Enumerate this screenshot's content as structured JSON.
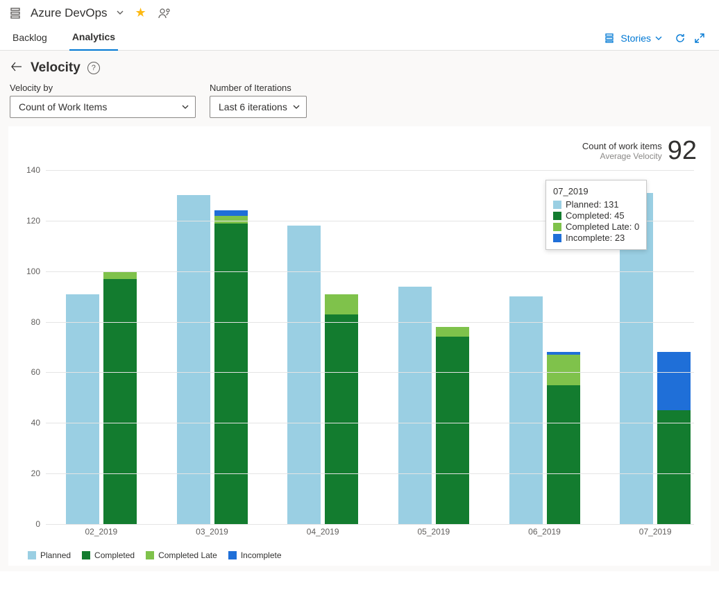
{
  "header": {
    "project": "Azure DevOps"
  },
  "tabs": {
    "backlog": "Backlog",
    "analytics": "Analytics"
  },
  "toolbar": {
    "stories_label": "Stories"
  },
  "page": {
    "title": "Velocity"
  },
  "filters": {
    "velocity_by_label": "Velocity by",
    "velocity_by_value": "Count of Work Items",
    "iterations_label": "Number of Iterations",
    "iterations_value": "Last 6 iterations"
  },
  "metric": {
    "line1": "Count of work items",
    "line2": "Average Velocity",
    "value": "92"
  },
  "legend": {
    "planned": "Planned",
    "completed": "Completed",
    "late": "Completed Late",
    "incomplete": "Incomplete"
  },
  "tooltip": {
    "title": "07_2019",
    "rows": [
      {
        "label": "Planned: 131",
        "color": "#9acfe3"
      },
      {
        "label": "Completed: 45",
        "color": "#137c2f"
      },
      {
        "label": "Completed Late: 0",
        "color": "#7fc24b"
      },
      {
        "label": "Incomplete: 23",
        "color": "#1f6fd8"
      }
    ]
  },
  "chart_data": {
    "type": "bar",
    "title": "Velocity",
    "xlabel": "",
    "ylabel": "",
    "ylim": [
      0,
      140
    ],
    "yticks": [
      0,
      20,
      40,
      60,
      80,
      100,
      120,
      140
    ],
    "categories": [
      "02_2019",
      "03_2019",
      "04_2019",
      "05_2019",
      "06_2019",
      "07_2019"
    ],
    "series": [
      {
        "name": "Planned",
        "values": [
          91,
          130,
          118,
          94,
          90,
          131
        ],
        "color": "#9acfe3",
        "stack": "a"
      },
      {
        "name": "Completed",
        "values": [
          97,
          119,
          83,
          74,
          55,
          45
        ],
        "color": "#137c2f",
        "stack": "b"
      },
      {
        "name": "Completed Late",
        "values": [
          3,
          3,
          8,
          4,
          12,
          0
        ],
        "color": "#7fc24b",
        "stack": "b"
      },
      {
        "name": "Incomplete",
        "values": [
          0,
          2,
          0,
          0,
          1,
          23
        ],
        "color": "#1f6fd8",
        "stack": "b"
      }
    ]
  }
}
